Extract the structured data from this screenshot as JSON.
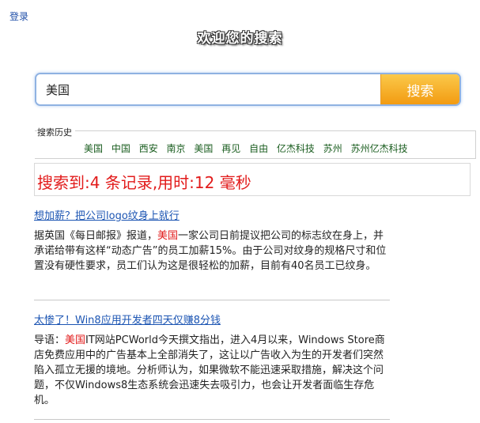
{
  "header": {
    "login_label": "登录",
    "title": "欢迎您的搜索"
  },
  "search": {
    "value": "美国",
    "button_label": "搜索"
  },
  "history": {
    "label": "搜索历史",
    "items": [
      "美国",
      "中国",
      "西安",
      "南京",
      "美国",
      "再见",
      "自由",
      "亿杰科技",
      "苏州",
      "苏州亿杰科技"
    ]
  },
  "summary": {
    "text": "搜索到:4 条记录,用时:12 毫秒"
  },
  "results": [
    {
      "title": "想加薪？把公司logo纹身上就行",
      "desc_pre": "据英国《每日邮报》报道，",
      "desc_hl": "美国",
      "desc_post": "一家公司日前提议把公司的标志纹在身上，并承诺给带有这样“动态广告”的员工加薪15%。由于公司对纹身的规格尺寸和位置没有硬性要求，员工们认为这是很轻松的加薪，目前有40名员工已纹身。"
    },
    {
      "title": "太惨了！Win8应用开发者四天仅赚8分钱",
      "desc_pre": "导语：",
      "desc_hl": "美国",
      "desc_post": "IT网站PCWorld今天撰文指出，进入4月以来，Windows Store商店免费应用中的广告基本上全部消失了，这让以广告收入为生的开发者们突然陷入孤立无援的境地。分析师认为，如果微软不能迅速采取措施，解决这个问题，不仅Windows8生态系统会迅速失去吸引力，也会让开发者面临生存危机。"
    }
  ]
}
